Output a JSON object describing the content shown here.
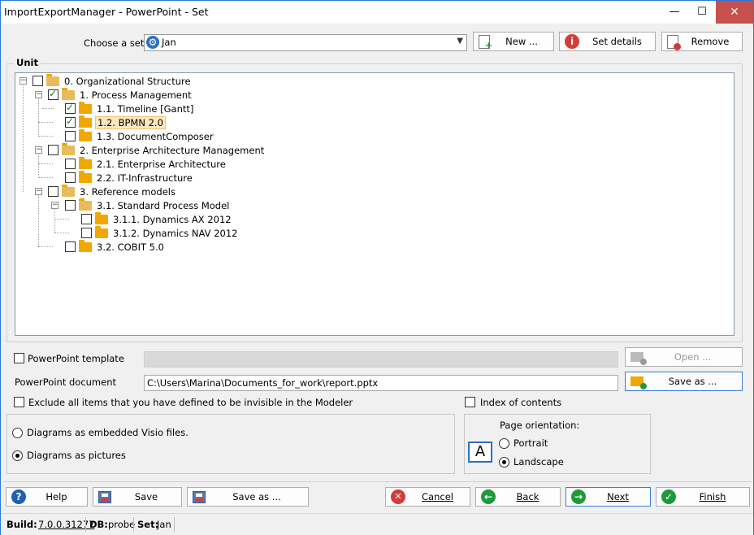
{
  "window": {
    "title": "ImportExportManager - PowerPoint - Set",
    "minimize": "—",
    "maximize": "☐",
    "close": "✕"
  },
  "set_row": {
    "label": "Choose a set",
    "selected": "Jan",
    "new_btn": "New ...",
    "details_btn": "Set details",
    "remove_btn": "Remove"
  },
  "unit": {
    "label": "Unit",
    "tree": [
      {
        "label": "0. Organizational Structure",
        "checked": false,
        "icon": "folder-open-icon"
      },
      {
        "label": "1. Process Management",
        "checked": true,
        "icon": "folder-open-icon"
      },
      {
        "label": "1.1. Timeline [Gantt]",
        "checked": true,
        "icon": "folder-icon"
      },
      {
        "label": "1.2. BPMN 2.0",
        "checked": true,
        "icon": "folder-icon",
        "selected": true
      },
      {
        "label": "1.3. DocumentComposer",
        "checked": false,
        "icon": "folder-icon"
      },
      {
        "label": "2. Enterprise Architecture Management",
        "checked": false,
        "icon": "folder-open-icon"
      },
      {
        "label": "2.1. Enterprise Architecture",
        "checked": false,
        "icon": "folder-icon"
      },
      {
        "label": "2.2. IT-Infrastructure",
        "checked": false,
        "icon": "folder-icon"
      },
      {
        "label": "3. Reference models",
        "checked": false,
        "icon": "folder-open-icon"
      },
      {
        "label": "3.1. Standard Process Model",
        "checked": false,
        "icon": "folder-open-icon"
      },
      {
        "label": "3.1.1. Dynamics AX 2012",
        "checked": false,
        "icon": "folder-icon"
      },
      {
        "label": "3.1.2. Dynamics NAV 2012",
        "checked": false,
        "icon": "folder-icon"
      },
      {
        "label": "3.2. COBIT 5.0",
        "checked": false,
        "icon": "folder-icon"
      }
    ]
  },
  "options": {
    "template_label": "PowerPoint template",
    "template_value": "",
    "open_btn": "Open ...",
    "document_label": "PowerPoint document",
    "document_value": "C:\\Users\\Marina\\Documents_for_work\\report.pptx",
    "saveas_btn": "Save as ...",
    "exclude_label": "Exclude all items that you have defined to be invisible in the Modeler",
    "index_label": "Index of contents",
    "diagrams_visio": "Diagrams as embedded Visio files.",
    "diagrams_pictures": "Diagrams as pictures",
    "orientation_label": "Page orientation:",
    "orientation_icon_letter": "A",
    "portrait": "Portrait",
    "landscape": "Landscape"
  },
  "buttons": {
    "help": "Help",
    "save": "Save",
    "save_as": "Save as ...",
    "cancel": "Cancel",
    "back": "Back",
    "next": "Next",
    "finish": "Finish"
  },
  "status": {
    "build_label": "Build:",
    "build_value": "7.0.0.31277",
    "db_label": "DB:",
    "db_value": "probe",
    "set_label": "Set:",
    "set_value": "Jan"
  },
  "colors": {
    "accent_border": "#2b79d8",
    "close_red": "#c75050",
    "help_blue": "#1f5fb4",
    "cancel_red": "#d63a3a",
    "nav_green": "#1f9a3a",
    "folder": "#f0a800"
  }
}
